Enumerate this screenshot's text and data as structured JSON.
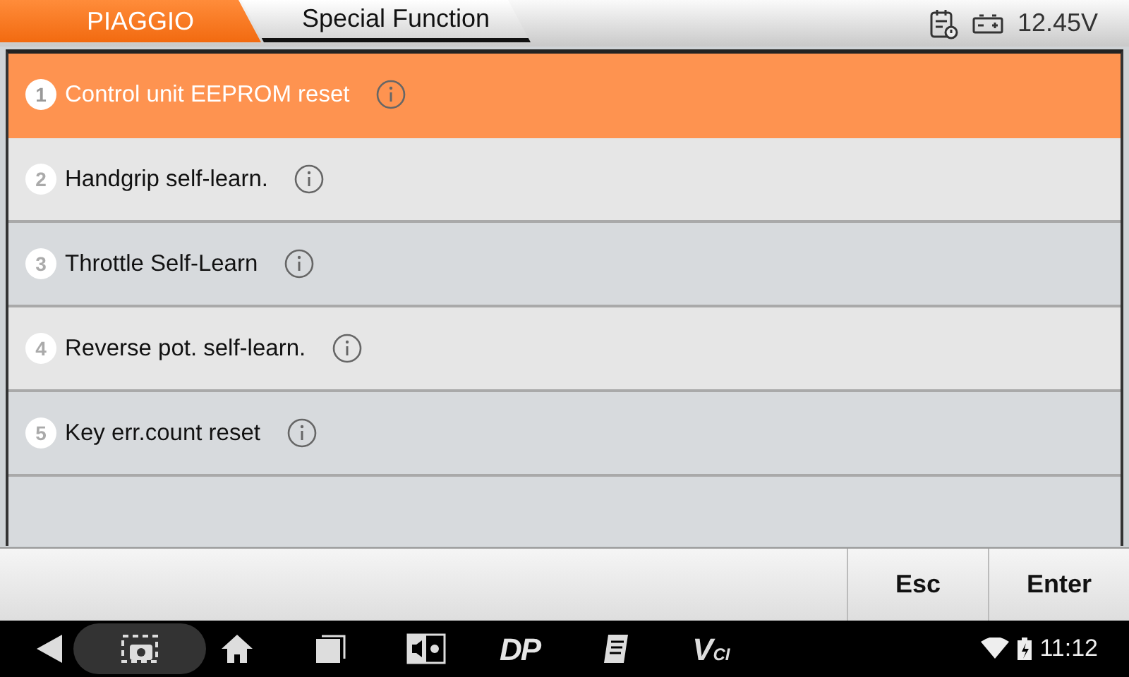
{
  "breadcrumb": [
    {
      "label": "PIAGGIO",
      "selected": true
    },
    {
      "label": "Special Function",
      "selected": false
    }
  ],
  "status": {
    "voltage": "12.45V"
  },
  "functions": [
    {
      "number": "1",
      "label": "Control unit EEPROM reset",
      "selected": true
    },
    {
      "number": "2",
      "label": "Handgrip self-learn.",
      "selected": false
    },
    {
      "number": "3",
      "label": "Throttle Self-Learn",
      "selected": false
    },
    {
      "number": "4",
      "label": "Reverse pot. self-learn.",
      "selected": false
    },
    {
      "number": "5",
      "label": "Key err.count reset",
      "selected": false
    }
  ],
  "buttons": [
    "Esc",
    "Enter"
  ],
  "nav_bar": {
    "dp_logo": "DP",
    "vci_logo_v": "V",
    "vci_logo_ci": "CI",
    "time": "11:12"
  }
}
